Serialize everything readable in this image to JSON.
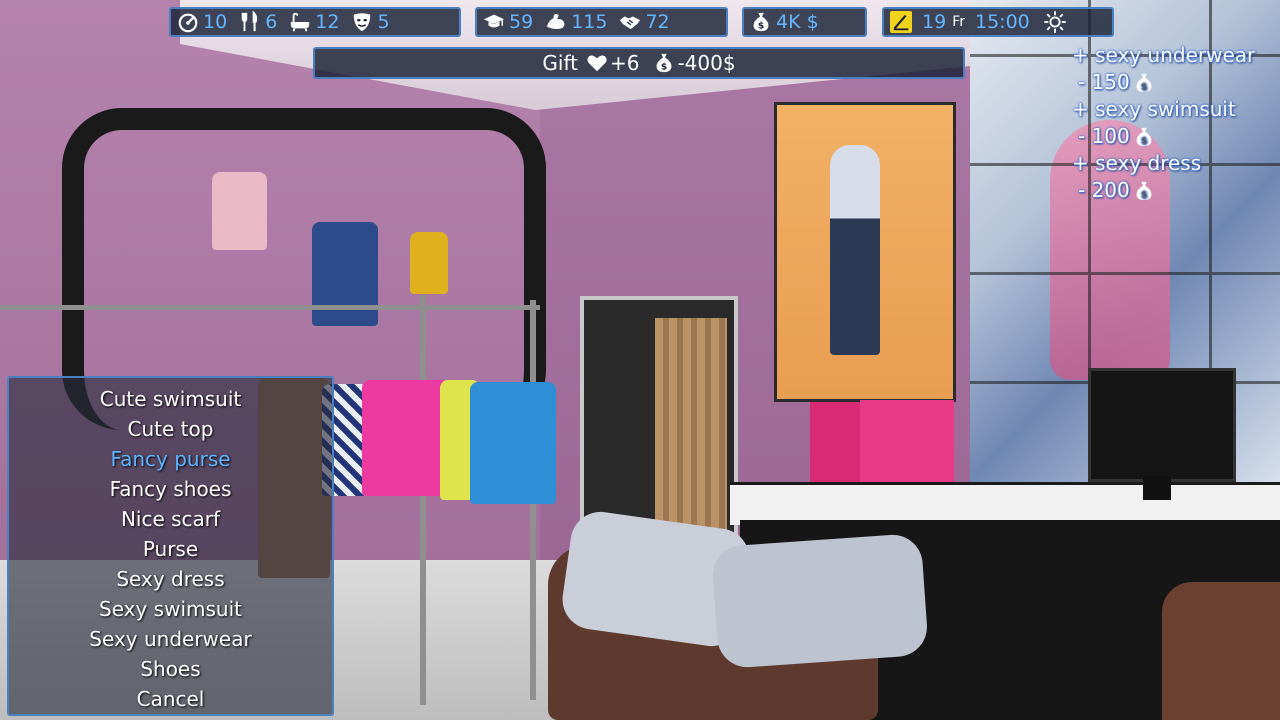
{
  "hud": {
    "stats_group1": [
      {
        "icon": "speedometer-icon",
        "value": "10"
      },
      {
        "icon": "fork-knife-icon",
        "value": "6"
      },
      {
        "icon": "bathtub-icon",
        "value": "12"
      },
      {
        "icon": "mask-icon",
        "value": "5"
      }
    ],
    "stats_group2": [
      {
        "icon": "graduation-cap-icon",
        "value": "59"
      },
      {
        "icon": "flexed-arm-icon",
        "value": "115"
      },
      {
        "icon": "handshake-icon",
        "value": "72"
      }
    ],
    "money": {
      "icon": "money-bag-icon",
      "value": "4K $"
    },
    "time": {
      "icon": "calendar-icon",
      "day": "19",
      "weekday": "Fr",
      "clock": "15:00",
      "weather_icon": "sun-icon"
    }
  },
  "gift_bar": {
    "label": "Gift",
    "heart_icon": "heart-icon",
    "affection": "+6",
    "money_icon": "money-bag-icon",
    "cost": "-400$"
  },
  "notifications": [
    {
      "text": "+ sexy underwear",
      "kind": "item"
    },
    {
      "text": "- 150",
      "kind": "cost",
      "icon": "money-bag-icon"
    },
    {
      "text": "+ sexy swimsuit",
      "kind": "item"
    },
    {
      "text": "- 100",
      "kind": "cost",
      "icon": "money-bag-icon"
    },
    {
      "text": "+ sexy dress",
      "kind": "item"
    },
    {
      "text": "- 200",
      "kind": "cost",
      "icon": "money-bag-icon"
    }
  ],
  "menu": {
    "selected_index": 2,
    "items": [
      "Cute swimsuit",
      "Cute top",
      "Fancy purse",
      "Fancy shoes",
      "Nice scarf",
      "Purse",
      "Sexy dress",
      "Sexy swimsuit",
      "Sexy underwear",
      "Shoes",
      "Cancel"
    ]
  },
  "colors": {
    "hud_text": "#63b6ff",
    "hud_border": "#4a7fc0",
    "menu_selected": "#5db3ff",
    "wall": "#a977a4"
  }
}
